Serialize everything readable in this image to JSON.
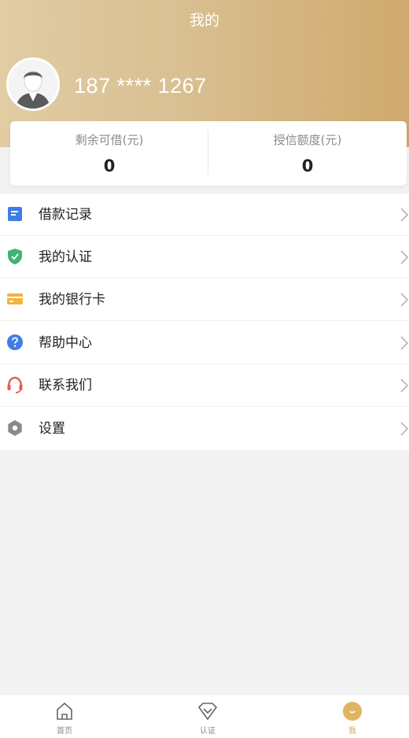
{
  "header": {
    "title": "我的",
    "phone": "187 **** 1267"
  },
  "credit": {
    "remaining_label": "剩余可借(元)",
    "remaining_value": "0",
    "limit_label": "授信额度(元)",
    "limit_value": "0"
  },
  "menu": {
    "items": [
      {
        "label": "借款记录",
        "icon": "document-icon",
        "color": "#3f7de8"
      },
      {
        "label": "我的认证",
        "icon": "shield-check-icon",
        "color": "#3cb478"
      },
      {
        "label": "我的银行卡",
        "icon": "bank-card-icon",
        "color": "#f2b43c"
      },
      {
        "label": "帮助中心",
        "icon": "question-icon",
        "color": "#3f7de8"
      },
      {
        "label": "联系我们",
        "icon": "headset-icon",
        "color": "#e85a4f"
      },
      {
        "label": "设置",
        "icon": "gear-icon",
        "color": "#8a8a8a"
      }
    ]
  },
  "tabbar": {
    "tabs": [
      {
        "label": "首页",
        "icon": "home-icon"
      },
      {
        "label": "认证",
        "icon": "diamond-icon"
      },
      {
        "label": "我",
        "icon": "person-icon",
        "active": true
      }
    ]
  },
  "colors": {
    "brand_gold": "#d2a55a",
    "header_gradient_start": "#e1cca4",
    "header_gradient_end": "#cfa96d"
  }
}
